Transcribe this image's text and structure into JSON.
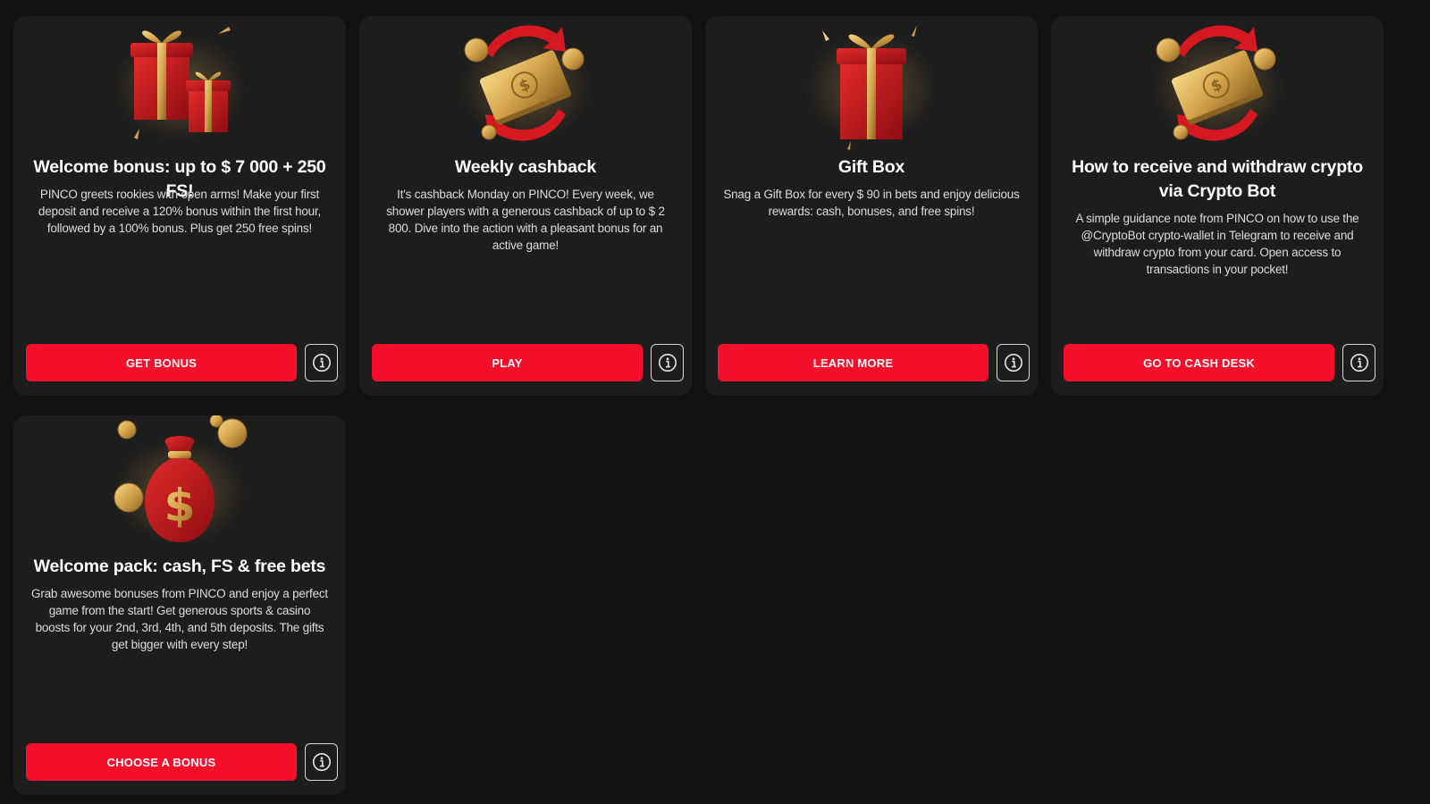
{
  "cards": [
    {
      "title": "Welcome bonus: up to $ 7 000 + 250 FS!",
      "description": "PINCO greets rookies with open arms! Make your first deposit and receive a 120% bonus within the first hour, followed by a 100% bonus. Plus get 250 free spins!",
      "button": "GET BONUS",
      "image": "gift-boxes-icon"
    },
    {
      "title": "Weekly cashback",
      "description": "It's cashback Monday on PINCO! Every week, we shower players with a generous cashback of up to $ 2 800. Dive into the action with a pleasant bonus for an active game!",
      "button": "PLAY",
      "image": "cashback-money-icon"
    },
    {
      "title": "Gift Box",
      "description": "Snag a Gift Box for every $ 90 in bets and enjoy delicious rewards: cash, bonuses, and free spins!",
      "button": "LEARN MORE",
      "image": "gift-box-icon"
    },
    {
      "title": "How to receive and withdraw crypto via Crypto Bot",
      "description": "A simple guidance note from PINCO on how to use the @CryptoBot crypto-wallet in Telegram to receive and withdraw crypto from your card. Open access to transactions in your pocket!",
      "button": "GO TO CASH DESK",
      "image": "cashback-money-icon"
    },
    {
      "title": "Welcome pack: cash, FS & free bets",
      "description": "Grab awesome bonuses from PINCO and enjoy a perfect game from the start! Get generous sports & casino boosts for your 2nd, 3rd, 4th, and 5th deposits. The gifts get bigger with every step!",
      "button": "CHOOSE A BONUS",
      "image": "money-bag-icon"
    }
  ],
  "info_icon": "info-icon",
  "colors": {
    "page_bg": "#121212",
    "card_bg": "#1d1d1d",
    "button_red": "#f50f2a",
    "gift_red": "#c8141e",
    "gold": "#d4a24a"
  }
}
